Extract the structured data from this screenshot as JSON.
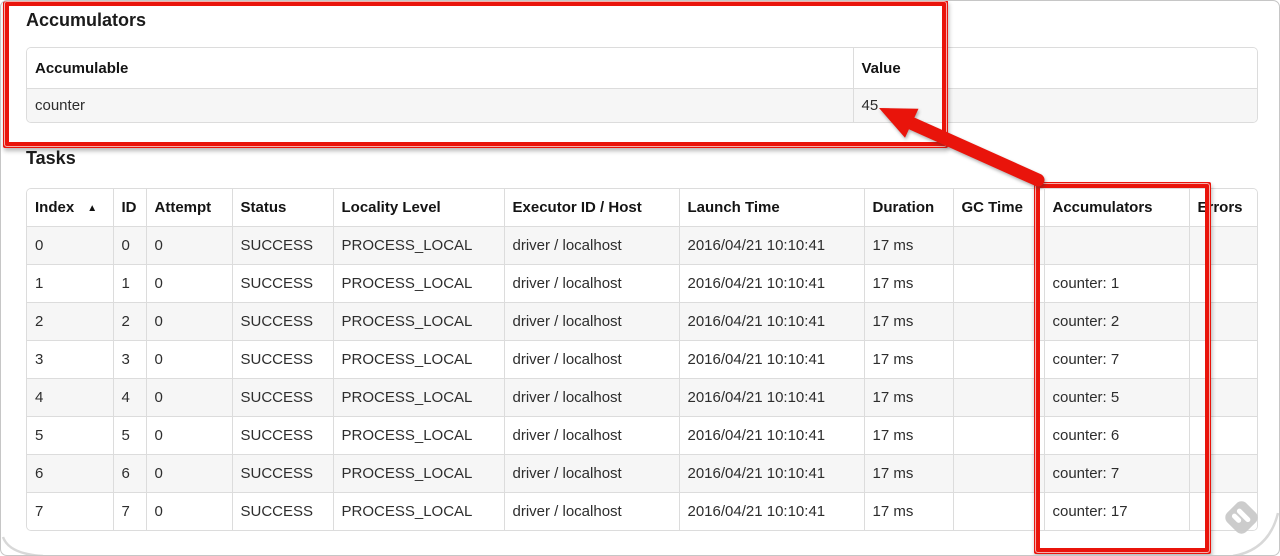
{
  "page": {
    "accumulators_section": {
      "title": "Accumulators",
      "table": {
        "headers": [
          "Accumulable",
          "Value"
        ],
        "rows": [
          [
            "counter",
            "45"
          ]
        ]
      }
    },
    "tasks_section": {
      "title": "Tasks",
      "table": {
        "headers": [
          "Index",
          "ID",
          "Attempt",
          "Status",
          "Locality Level",
          "Executor ID / Host",
          "Launch Time",
          "Duration",
          "GC Time",
          "Accumulators",
          "Errors"
        ],
        "sort_column": "Index",
        "sort_icon": "▲",
        "rows": [
          [
            "0",
            "0",
            "0",
            "SUCCESS",
            "PROCESS_LOCAL",
            "driver / localhost",
            "2016/04/21 10:10:41",
            "17 ms",
            "",
            "",
            ""
          ],
          [
            "1",
            "1",
            "0",
            "SUCCESS",
            "PROCESS_LOCAL",
            "driver / localhost",
            "2016/04/21 10:10:41",
            "17 ms",
            "",
            "counter: 1",
            ""
          ],
          [
            "2",
            "2",
            "0",
            "SUCCESS",
            "PROCESS_LOCAL",
            "driver / localhost",
            "2016/04/21 10:10:41",
            "17 ms",
            "",
            "counter: 2",
            ""
          ],
          [
            "3",
            "3",
            "0",
            "SUCCESS",
            "PROCESS_LOCAL",
            "driver / localhost",
            "2016/04/21 10:10:41",
            "17 ms",
            "",
            "counter: 7",
            ""
          ],
          [
            "4",
            "4",
            "0",
            "SUCCESS",
            "PROCESS_LOCAL",
            "driver / localhost",
            "2016/04/21 10:10:41",
            "17 ms",
            "",
            "counter: 5",
            ""
          ],
          [
            "5",
            "5",
            "0",
            "SUCCESS",
            "PROCESS_LOCAL",
            "driver / localhost",
            "2016/04/21 10:10:41",
            "17 ms",
            "",
            "counter: 6",
            ""
          ],
          [
            "6",
            "6",
            "0",
            "SUCCESS",
            "PROCESS_LOCAL",
            "driver / localhost",
            "2016/04/21 10:10:41",
            "17 ms",
            "",
            "counter: 7",
            ""
          ],
          [
            "7",
            "7",
            "0",
            "SUCCESS",
            "PROCESS_LOCAL",
            "driver / localhost",
            "2016/04/21 10:10:41",
            "17 ms",
            "",
            "counter: 17",
            ""
          ]
        ]
      }
    },
    "annotations": {
      "highlight_color": "#e9140b",
      "arrow_target_value": "45"
    }
  }
}
